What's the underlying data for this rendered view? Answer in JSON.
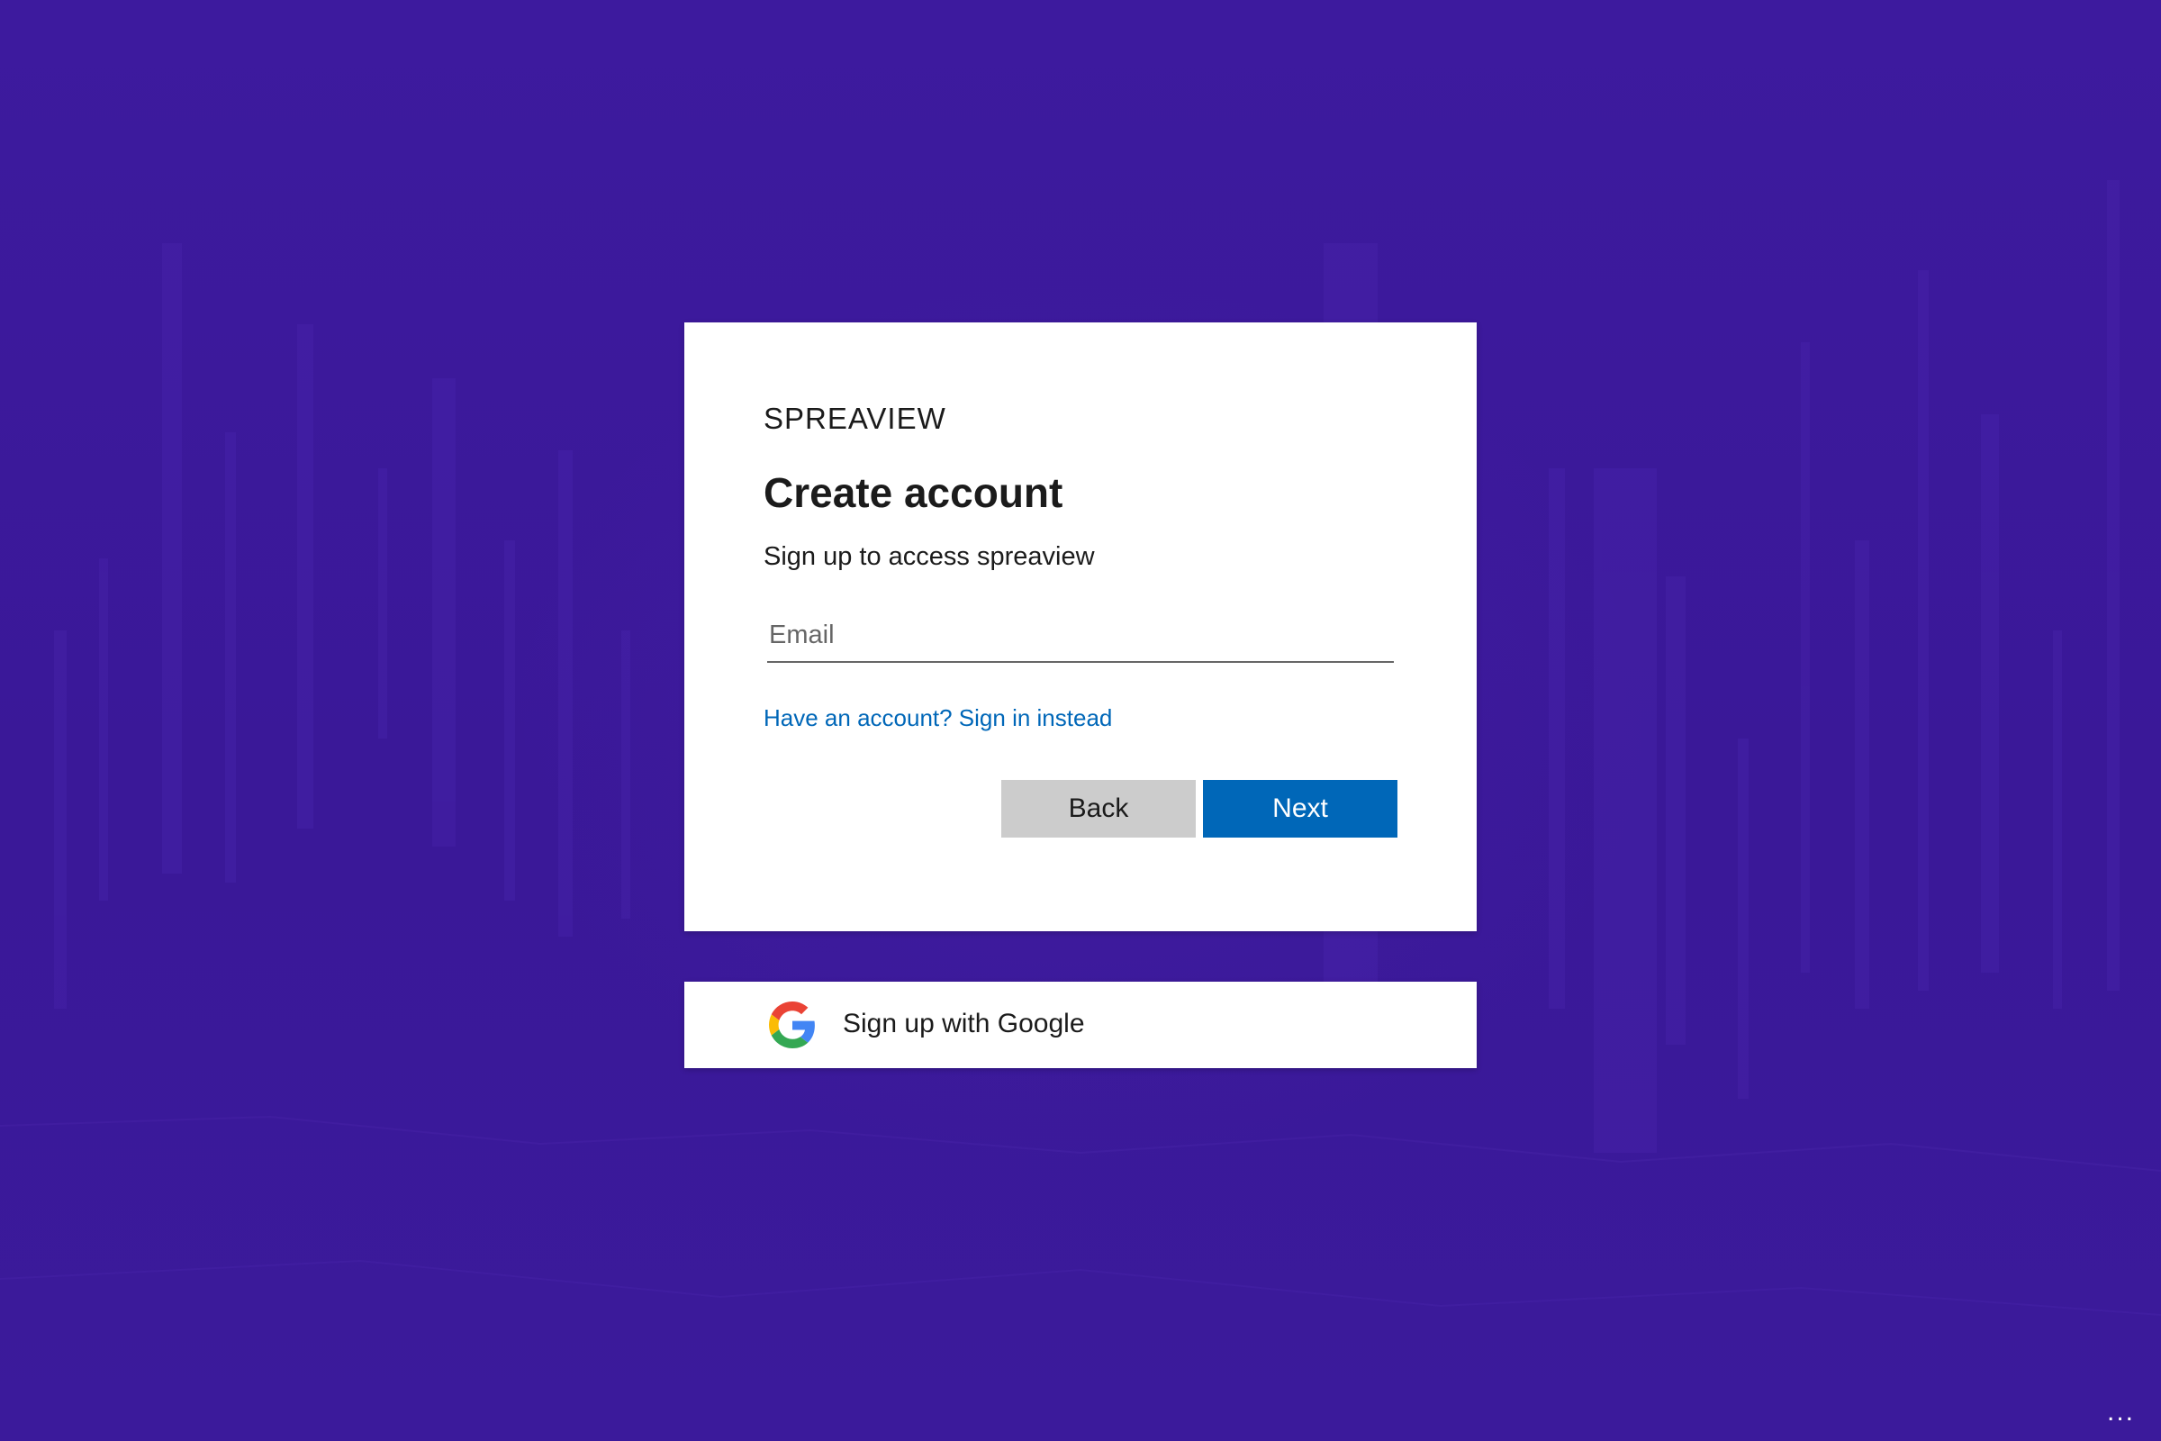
{
  "signup": {
    "brand": "SPREAVIEW",
    "title": "Create account",
    "subtitle": "Sign up to access spreaview",
    "email_placeholder": "Email",
    "email_value": "",
    "signin_link": "Have an account? Sign in instead",
    "back_label": "Back",
    "next_label": "Next"
  },
  "google": {
    "label": "Sign up with Google",
    "icon": "google-icon"
  },
  "footer": {
    "more_label": "...",
    "more_icon": "more-options-icon"
  },
  "colors": {
    "background": "#3b1a9c",
    "accent": "#0067b8",
    "back_button": "#cccccc",
    "text": "#1b1b1b"
  }
}
